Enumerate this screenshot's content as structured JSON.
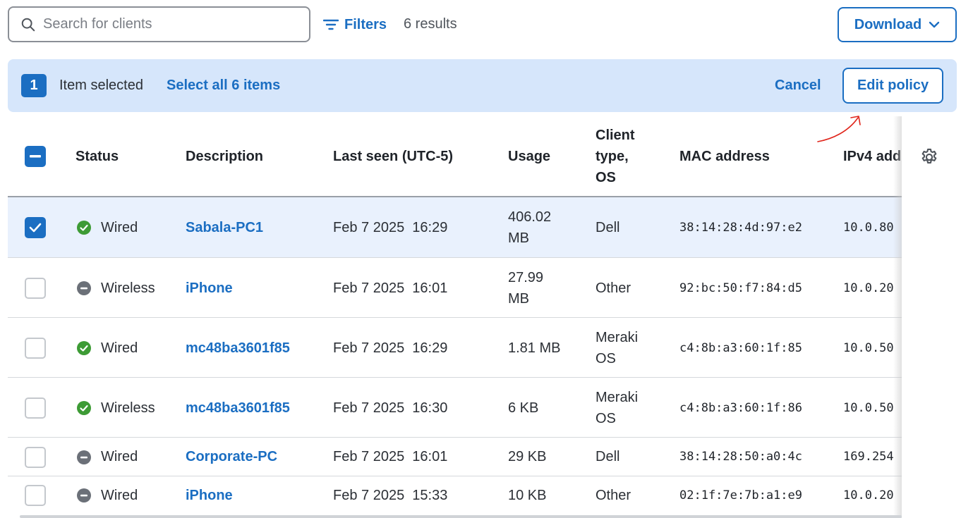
{
  "toolbar": {
    "search_placeholder": "Search for clients",
    "filters_label": "Filters",
    "results": "6 results",
    "download_label": "Download"
  },
  "selection": {
    "count": "1",
    "text": "Item selected",
    "select_all": "Select all 6 items",
    "cancel": "Cancel",
    "edit_policy": "Edit policy"
  },
  "table": {
    "columns": {
      "status": "Status",
      "description": "Description",
      "last_seen": "Last seen (UTC-5)",
      "usage": "Usage",
      "client_type_1": "Client",
      "client_type_2": "type,",
      "client_type_3": "OS",
      "mac": "MAC address",
      "ipv4": "IPv4 add"
    },
    "rows": [
      {
        "status": "Wired",
        "description": "Sabala-PC1",
        "last_seen": "Feb 7 2025  16:29",
        "usage_1": "406.02",
        "usage_2": "MB",
        "type_1": "Dell",
        "type_2": "",
        "mac": "38:14:28:4d:97:e2",
        "ipv4": "10.0.80"
      },
      {
        "status": "Wireless",
        "description": "iPhone",
        "last_seen": "Feb 7 2025  16:01",
        "usage_1": "27.99",
        "usage_2": "MB",
        "type_1": "Other",
        "type_2": "",
        "mac": "92:bc:50:f7:84:d5",
        "ipv4": "10.0.20"
      },
      {
        "status": "Wired",
        "description": "mc48ba3601f85",
        "last_seen": "Feb 7 2025  16:29",
        "usage_1": "1.81 MB",
        "usage_2": "",
        "type_1": "Meraki",
        "type_2": "OS",
        "mac": "c4:8b:a3:60:1f:85",
        "ipv4": "10.0.50"
      },
      {
        "status": "Wireless",
        "description": "mc48ba3601f85",
        "last_seen": "Feb 7 2025  16:30",
        "usage_1": "6 KB",
        "usage_2": "",
        "type_1": "Meraki",
        "type_2": "OS",
        "mac": "c4:8b:a3:60:1f:86",
        "ipv4": "10.0.50"
      },
      {
        "status": "Wired",
        "description": "Corporate-PC",
        "last_seen": "Feb 7 2025  16:01",
        "usage_1": "29 KB",
        "usage_2": "",
        "type_1": "Dell",
        "type_2": "",
        "mac": "38:14:28:50:a0:4c",
        "ipv4": "169.254"
      },
      {
        "status": "Wired",
        "description": "iPhone",
        "last_seen": "Feb 7 2025  15:33",
        "usage_1": "10 KB",
        "usage_2": "",
        "type_1": "Other",
        "type_2": "",
        "mac": "02:1f:7e:7b:a1:e9",
        "ipv4": "10.0.20"
      }
    ]
  },
  "colors": {
    "accent": "#1b6ec2",
    "online": "#3d9b35",
    "offline": "#6b7078",
    "banner": "#d6e6fb",
    "selected_row": "#e9f1fd"
  }
}
